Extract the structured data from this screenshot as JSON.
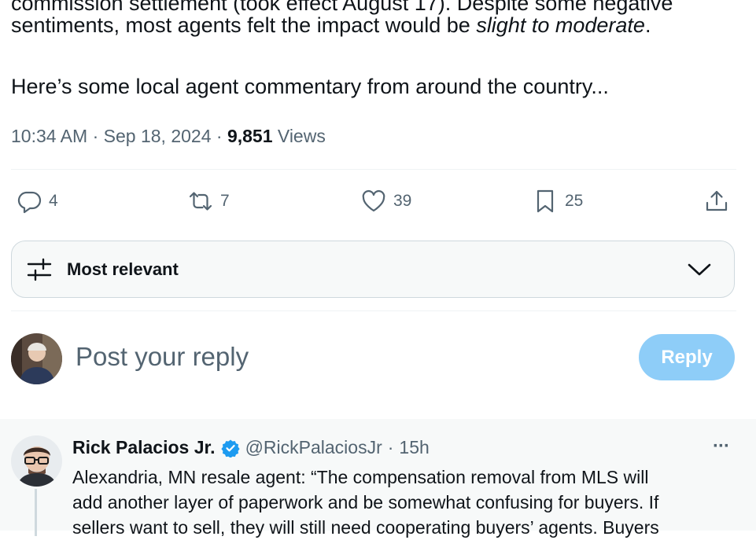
{
  "tweet": {
    "line1": "commission settlement (took effect August 17). Despite some negative",
    "line2_prefix": "sentiments, most agents felt the impact would be ",
    "line2_emphasis": "slight to moderate",
    "line2_suffix": ".",
    "line3": "Here’s some local agent commentary from around the country...",
    "time": "10:34 AM",
    "date": "Sep 18, 2024",
    "separator": "·",
    "views_count": "9,851",
    "views_label": "Views"
  },
  "actions": {
    "replies": "4",
    "reposts": "7",
    "likes": "39",
    "bookmarks": "25"
  },
  "sort": {
    "label": "Most relevant"
  },
  "composer": {
    "placeholder": "Post your reply",
    "button": "Reply"
  },
  "reply": {
    "name": "Rick Palacios Jr.",
    "handle": "@RickPalaciosJr",
    "separator": "·",
    "time": "15h",
    "more": "···",
    "line1": "Alexandria, MN resale agent: “The compensation removal from MLS will",
    "line2": "add another layer of paperwork and be somewhat confusing for buyers. If",
    "line3": "sellers want to sell, they will still need cooperating buyers’ agents. Buyers"
  },
  "colors": {
    "accent": "#1d9bf0",
    "reply_button_disabled": "#8ecdf8",
    "muted_text": "#536471"
  },
  "icons": {
    "reply": "speech-bubble-icon",
    "repost": "repost-arrows-icon",
    "like": "heart-icon",
    "bookmark": "bookmark-icon",
    "share": "share-upload-icon",
    "sort": "sliders-icon",
    "dropdown": "chevron-down-icon",
    "verified": "verified-badge-icon"
  }
}
